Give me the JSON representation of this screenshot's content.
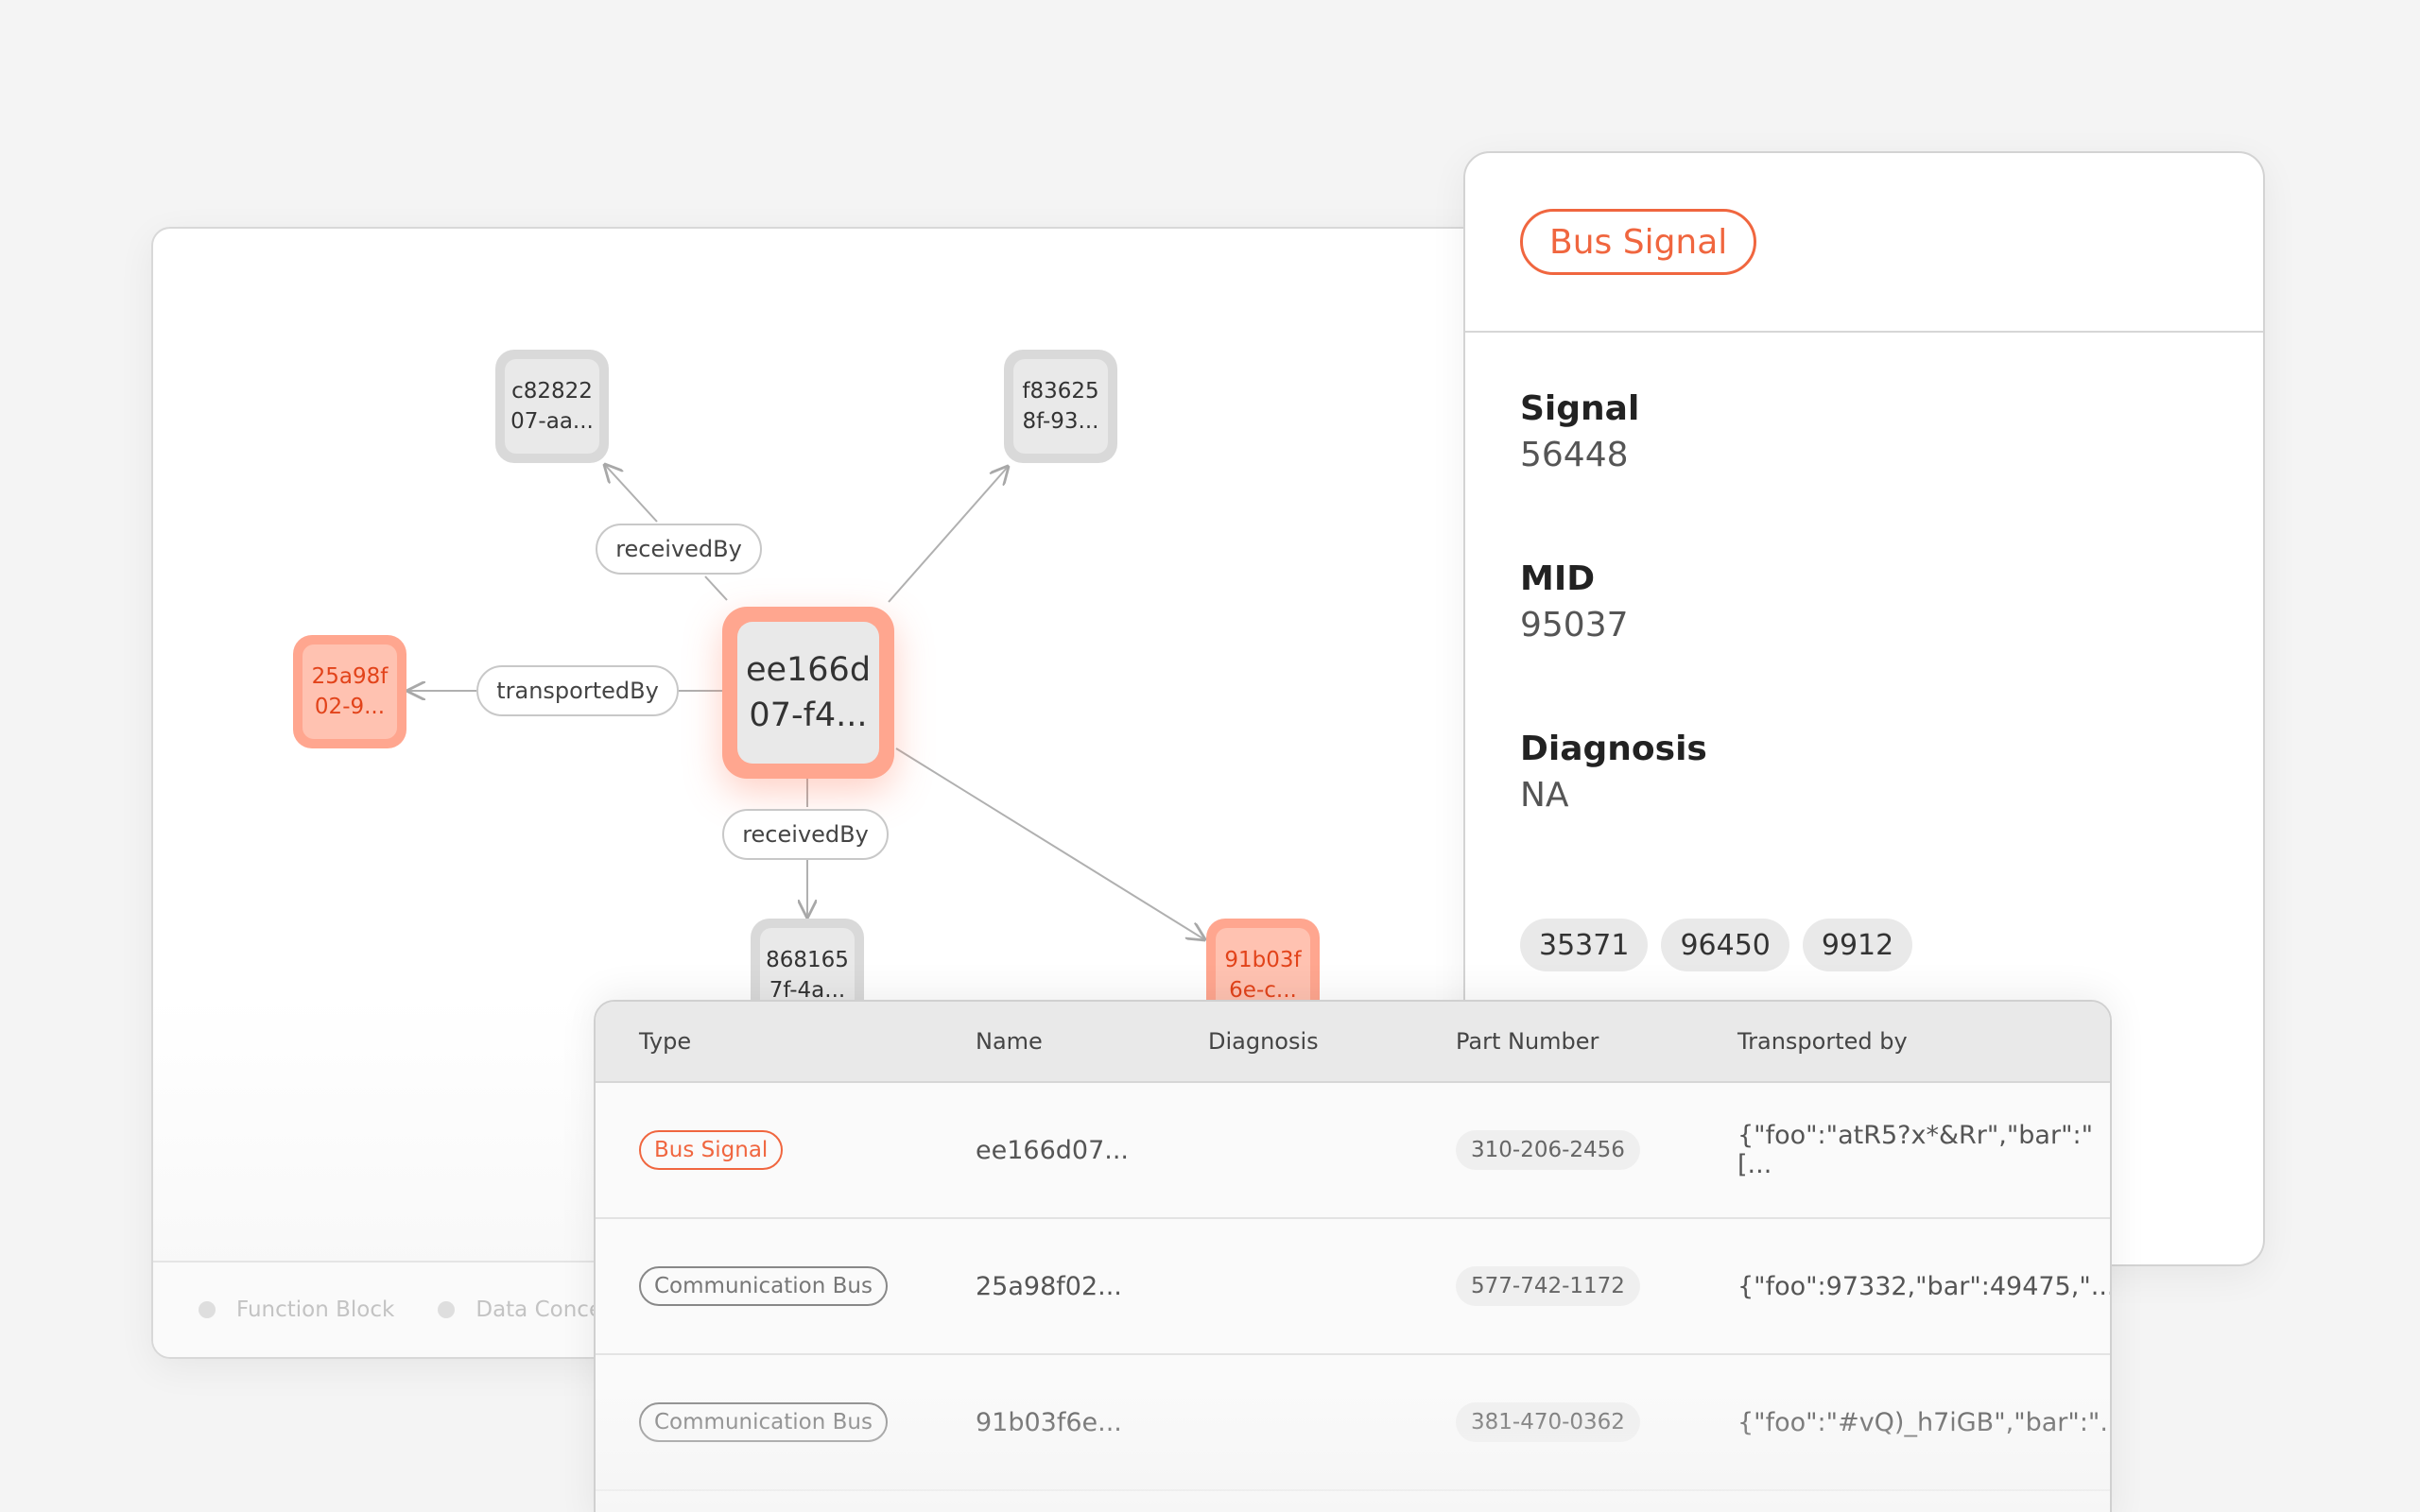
{
  "graph": {
    "nodes": {
      "center": {
        "line1": "ee166d",
        "line2": "07-f4..."
      },
      "top_left": {
        "line1": "c82822",
        "line2": "07-aa..."
      },
      "top_right": {
        "line1": "f83625",
        "line2": "8f-93..."
      },
      "left": {
        "line1": "25a98f",
        "line2": "02-9..."
      },
      "bottom": {
        "line1": "868165",
        "line2": "7f-4a..."
      },
      "bottom_right": {
        "line1": "91b03f",
        "line2": "6e-c..."
      }
    },
    "edges": {
      "received_by_top": "receivedBy",
      "transported_by": "transportedBy",
      "received_by_bottom": "receivedBy"
    },
    "legend": [
      "Function Block",
      "Data Conce"
    ]
  },
  "detail": {
    "type_badge": "Bus Signal",
    "fields": [
      {
        "label": "Signal",
        "value": "56448"
      },
      {
        "label": "MID",
        "value": "95037"
      },
      {
        "label": "Diagnosis",
        "value": "NA"
      }
    ],
    "chips": [
      "35371",
      "96450",
      "9912"
    ]
  },
  "table": {
    "columns": [
      "Type",
      "Name",
      "Diagnosis",
      "Part Number",
      "Transported by"
    ],
    "rows": [
      {
        "type": "Bus Signal",
        "name": "ee166d07...",
        "diagnosis": "",
        "part_number": "310-206-2456",
        "transported_by": "{\"foo\":\"atR5?x*&Rr\",\"bar\":\"[..."
      },
      {
        "type": "Communication Bus",
        "name": "25a98f02...",
        "diagnosis": "",
        "part_number": "577-742-1172",
        "transported_by": "{\"foo\":97332,\"bar\":49475,\"..."
      },
      {
        "type": "Communication Bus",
        "name": "91b03f6e...",
        "diagnosis": "",
        "part_number": "381-470-0362",
        "transported_by": "{\"foo\":\"#vQ)_h7iGB\",\"bar\":\"..."
      }
    ]
  },
  "colors": {
    "accent": "#f0663f",
    "node_red": "#ffa68f",
    "node_gray": "#d9d9d9"
  }
}
